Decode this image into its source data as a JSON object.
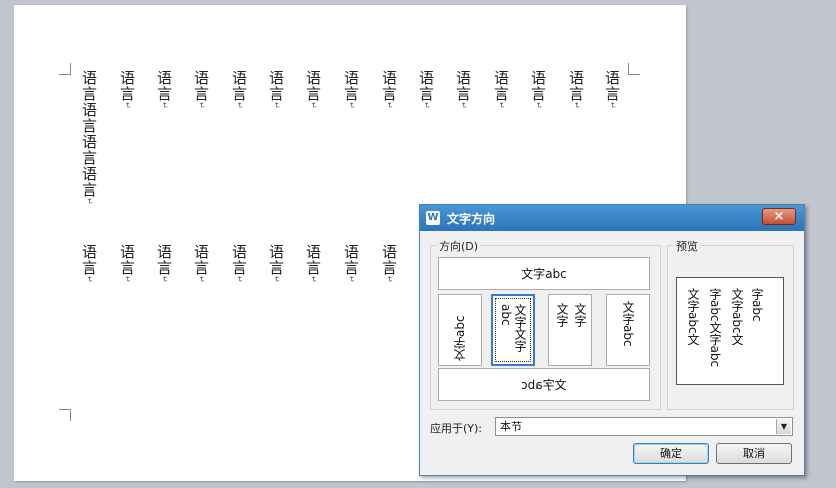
{
  "document": {
    "columns_row1": [
      {
        "text": "语言语言语言语言"
      },
      {
        "text": "语言"
      },
      {
        "text": "语言"
      },
      {
        "text": "语言"
      },
      {
        "text": "语言"
      },
      {
        "text": "语言"
      },
      {
        "text": "语言"
      },
      {
        "text": "语言"
      },
      {
        "text": "语言"
      },
      {
        "text": "语言"
      },
      {
        "text": "语言"
      },
      {
        "text": "语言"
      },
      {
        "text": "语言"
      },
      {
        "text": "语言"
      },
      {
        "text": "语言"
      }
    ],
    "columns_row2": [
      {
        "text": "语言"
      },
      {
        "text": "语言"
      },
      {
        "text": "语言"
      },
      {
        "text": "语言"
      },
      {
        "text": "语言"
      },
      {
        "text": "语言"
      },
      {
        "text": "语言"
      },
      {
        "text": "语言"
      },
      {
        "text": "语言"
      }
    ],
    "paragraph_mark": "↵"
  },
  "dialog": {
    "title": "文字方向",
    "close_label": "×",
    "direction_group_label": "方向(D)",
    "preview_group_label": "预览",
    "options": {
      "horizontal": "文字abc",
      "rotate_left": "文字abc",
      "vertical_stacked": "文字文字abc",
      "vertical_cjk_col1": "文字",
      "vertical_cjk_col2": "文字",
      "rotate_right": "文字abc",
      "horizontal_flipped": "文字abc"
    },
    "preview_columns": [
      "字abc",
      "文字abc文",
      "字abc文字abc",
      "文字abc文"
    ],
    "apply_label": "应用于(Y):",
    "apply_value": "本节",
    "ok_label": "确定",
    "cancel_label": "取消",
    "accent_color": "#2c73b8"
  }
}
